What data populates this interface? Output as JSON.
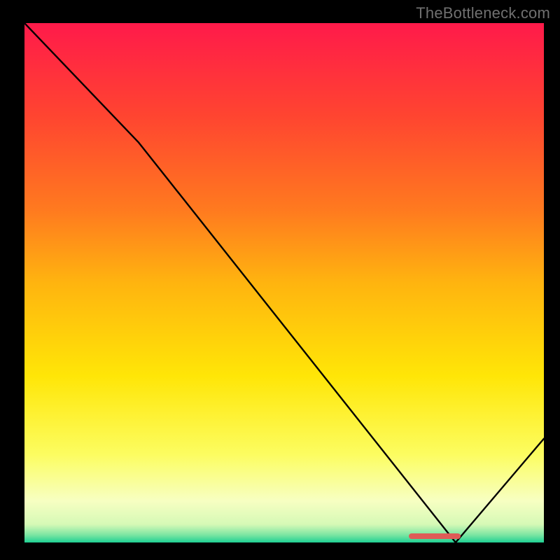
{
  "domain": "Chart",
  "watermark": "TheBottleneck.com",
  "chart_data": {
    "type": "line",
    "title": "",
    "xlabel": "",
    "ylabel": "",
    "xlim": [
      0,
      100
    ],
    "ylim": [
      0,
      100
    ],
    "x": [
      0,
      22,
      83,
      100
    ],
    "values": [
      100,
      77,
      0,
      20
    ],
    "series_color": "#000000",
    "background_gradient": {
      "stops": [
        {
          "offset": 0.0,
          "color": "#ff1a4a"
        },
        {
          "offset": 0.18,
          "color": "#ff4530"
        },
        {
          "offset": 0.36,
          "color": "#ff7a1f"
        },
        {
          "offset": 0.5,
          "color": "#ffb40f"
        },
        {
          "offset": 0.68,
          "color": "#ffe607"
        },
        {
          "offset": 0.83,
          "color": "#fcfd60"
        },
        {
          "offset": 0.92,
          "color": "#f7ffc2"
        },
        {
          "offset": 0.965,
          "color": "#d6f9b6"
        },
        {
          "offset": 0.985,
          "color": "#7ee6a3"
        },
        {
          "offset": 1.0,
          "color": "#1fd093"
        }
      ]
    },
    "optimum_marker": {
      "x_start": 74,
      "x_end": 84,
      "color": "#de5c57"
    }
  }
}
